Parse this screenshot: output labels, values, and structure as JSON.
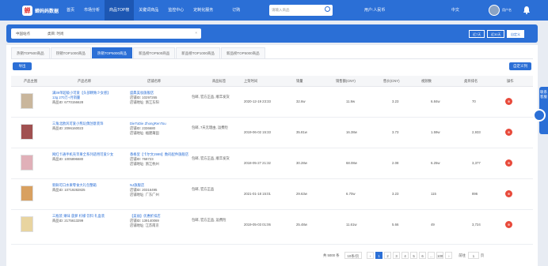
{
  "logo": {
    "mark": "蝉",
    "text": "蝉妈妈数据"
  },
  "nav": [
    "首页",
    "市场分析",
    "商品TOP榜",
    "关键词商品",
    "监控中心",
    "定制化服务",
    "订购"
  ],
  "search": {
    "placeholder": "请输入商品"
  },
  "top_right": {
    "account": "用户:人民币",
    "lang": "中文",
    "user": "用户名"
  },
  "filter": {
    "tags": [
      "中国站点",
      "类目: 时尚"
    ],
    "clear": "×"
  },
  "range_buttons": [
    "近7天",
    "近30天",
    "自定义"
  ],
  "tabs": [
    "热销TOP500商品",
    "热销TOP1000商品",
    "热销TOP5000商品",
    "新品榜TOP500商品",
    "新品榜TOP1000商品",
    "新品榜TOP5000商品"
  ],
  "active_tab": 2,
  "buttons": {
    "export": "导出",
    "custom": "自定义列"
  },
  "columns": [
    "产品主图",
    "产品名称",
    "店铺名称",
    "商品标签",
    "上架时间",
    "销量",
    "销售额(CNY)",
    "售价(CNY)",
    "视频数",
    "类目排名",
    "操作"
  ],
  "rows": [
    {
      "name": "满39单超级小可爱【头部精致少女感】13g 270万+月销量",
      "id": "商品ID: 6770156628",
      "shop": "盛典美妆旗舰店",
      "shop_id": "店铺ID: 10297265",
      "region": "店铺地址: 浙江东阳",
      "tags": "包邮, 官方正品, 顺丰发货",
      "date": "2020-12-19 23:33",
      "sales": "32.6w",
      "revenue": "11.9w",
      "price": "3.23",
      "videos": "6.84w",
      "rank": "70",
      "thumb": "#c9b69c"
    },
    {
      "name": "三角北欧风可爱小熊玩偶创意装饰",
      "id": "商品ID: 2096160023",
      "shop": "DieToDie ZhongRenTou",
      "shop_id": "店铺ID: 2336680",
      "region": "店铺地址: 福建莆田",
      "tags": "包邮, 7天无理由, 运费险",
      "date": "2019-06-02 15:33",
      "sales": "35.81w",
      "revenue": "16.38w",
      "price": "3.73",
      "videos": "1.59w",
      "rank": "2,933",
      "thumb": "#a05050"
    },
    {
      "name": "网红卡通手机壳苹果全系列适用可爱少女",
      "id": "商品ID: 1005896680",
      "shop": "香格里【卡尔文2999】数码配件旗舰店",
      "shop_id": "店铺ID: 768723",
      "region": "店铺地址: 浙江杭州",
      "tags": "包邮, 官方正品, 顺丰发货",
      "date": "2018-05-27 21:32",
      "sales": "30.28w",
      "revenue": "68.08w",
      "price": "2.08",
      "videos": "6.25w",
      "rank": "3,377",
      "thumb": "#e0b0b8"
    },
    {
      "name": "新鲜可口水果零食大礼包整箱",
      "id": "商品ID: 10719282825",
      "shop": "NJ旗舰店",
      "shop_id": "店铺ID: 20316495",
      "region": "店铺地址: 广东广州",
      "tags": "包邮, 官方正品",
      "date": "2021-01-18 15:01",
      "sales": "29.63w",
      "revenue": "6.70w",
      "price": "3.23",
      "videos": "115",
      "rank": "896",
      "thumb": "#d8a060"
    },
    {
      "name": "三瓶装 果味 菠萝 柠檬 饮料 礼盒装",
      "id": "商品ID: 2175613299",
      "shop": "【美丽】优惠折扣店",
      "shop_id": "店铺ID: 139140069",
      "region": "店铺地址: 江苏南京",
      "tags": "包邮, 官方正品, 运费险",
      "date": "2019-05-03 01:06",
      "sales": "25.48w",
      "revenue": "11.61w",
      "price": "5.66",
      "videos": "49",
      "rank": "3,724",
      "thumb": "#e8d4a0"
    }
  ],
  "pager": {
    "total": "共 5000 条",
    "per_page": "10条/页",
    "pages": [
      "1",
      "2",
      "3",
      "4",
      "5",
      "6",
      "…",
      "100"
    ],
    "goto": "前往",
    "goto_val": "1",
    "page_unit": "页"
  },
  "float_tab": "联系客服",
  "colors": {
    "brand": "#2b6fd6",
    "danger": "#e84a3b"
  }
}
